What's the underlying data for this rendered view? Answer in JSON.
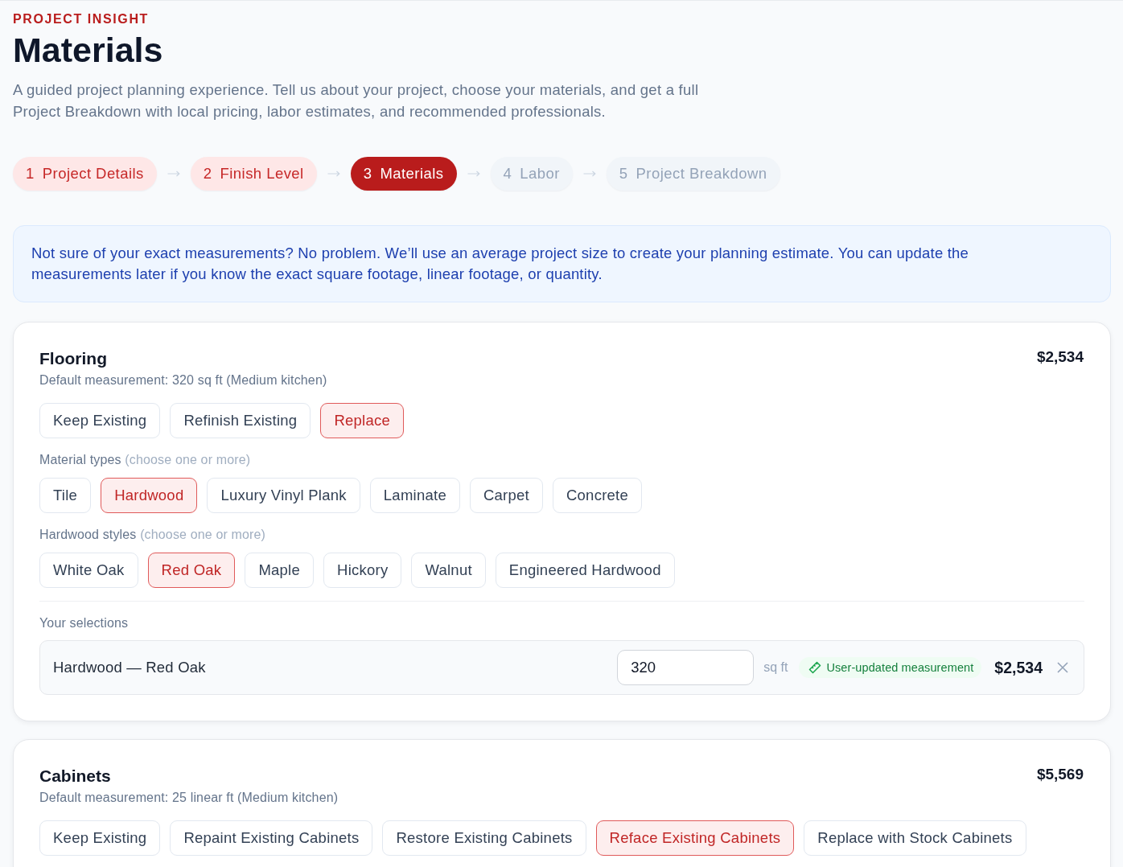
{
  "header": {
    "eyebrow": "PROJECT INSIGHT",
    "title": "Materials",
    "description": "A guided project planning experience. Tell us about your project, choose your materials, and get a full Project Breakdown with local pricing, labor estimates, and recommended professionals."
  },
  "steps": [
    {
      "number": "1",
      "label": "Project Details",
      "completed": true,
      "selected": false
    },
    {
      "number": "2",
      "label": "Finish Level",
      "completed": true,
      "selected": false
    },
    {
      "number": "3",
      "label": "Materials",
      "completed": false,
      "selected": true
    },
    {
      "number": "4",
      "label": "Labor",
      "completed": false,
      "selected": false
    },
    {
      "number": "5",
      "label": "Project Breakdown",
      "completed": false,
      "selected": false
    }
  ],
  "notice": {
    "text": "Not sure of your exact measurements? No problem. We’ll use an average project size to create your planning estimate. You can update the measurements later if you know the exact square footage, linear footage, or quantity."
  },
  "sections": [
    {
      "title": "Flooring",
      "price": "$2,534",
      "measurement": "Default measurement: 320 sq ft (Medium kitchen)",
      "options": [
        {
          "label": "Keep Existing",
          "selected": false
        },
        {
          "label": "Refinish Existing",
          "selected": false
        },
        {
          "label": "Replace",
          "selected": true
        }
      ],
      "groups": [
        {
          "label": "Material types",
          "hint": "(choose one or more)",
          "options": [
            {
              "label": "Tile",
              "selected": false
            },
            {
              "label": "Hardwood",
              "selected": true
            },
            {
              "label": "Luxury Vinyl Plank",
              "selected": false
            },
            {
              "label": "Laminate",
              "selected": false
            },
            {
              "label": "Carpet",
              "selected": false
            },
            {
              "label": "Concrete",
              "selected": false
            }
          ]
        },
        {
          "label": "Hardwood styles",
          "hint": "(choose one or more)",
          "options": [
            {
              "label": "White Oak",
              "selected": false
            },
            {
              "label": "Red Oak",
              "selected": true
            },
            {
              "label": "Maple",
              "selected": false
            },
            {
              "label": "Hickory",
              "selected": false
            },
            {
              "label": "Walnut",
              "selected": false
            },
            {
              "label": "Engineered Hardwood",
              "selected": false
            }
          ]
        }
      ],
      "selections_label": "Your selections",
      "selections": [
        {
          "name": "Hardwood — Red Oak",
          "quantity": "320",
          "unit": "sq ft",
          "badge": "User-updated measurement",
          "price": "$2,534"
        }
      ]
    },
    {
      "title": "Cabinets",
      "price": "$5,569",
      "measurement": "Default measurement: 25 linear ft (Medium kitchen)",
      "options": [
        {
          "label": "Keep Existing",
          "selected": false
        },
        {
          "label": "Repaint Existing Cabinets",
          "selected": false
        },
        {
          "label": "Restore Existing Cabinets",
          "selected": false
        },
        {
          "label": "Reface Existing Cabinets",
          "selected": true
        },
        {
          "label": "Replace with Stock Cabinets",
          "selected": false
        }
      ]
    }
  ]
}
